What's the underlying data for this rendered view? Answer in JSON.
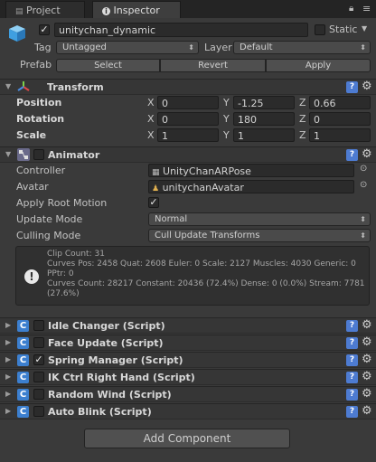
{
  "tabs": [
    {
      "label": "Project",
      "active": false
    },
    {
      "label": "Inspector",
      "active": true
    }
  ],
  "object": {
    "name": "unitychan_dynamic",
    "active": true,
    "static_label": "Static",
    "tag_label": "Tag",
    "tag_value": "Untagged",
    "layer_label": "Layer",
    "layer_value": "Default",
    "prefab_label": "Prefab",
    "prefab_buttons": [
      "Select",
      "Revert",
      "Apply"
    ]
  },
  "transform": {
    "title": "Transform",
    "rows": [
      {
        "label": "Position",
        "x": "0",
        "y": "-1.25",
        "z": "0.66"
      },
      {
        "label": "Rotation",
        "x": "0",
        "y": "180",
        "z": "0"
      },
      {
        "label": "Scale",
        "x": "1",
        "y": "1",
        "z": "1"
      }
    ],
    "axis_labels": [
      "X",
      "Y",
      "Z"
    ]
  },
  "animator": {
    "title": "Animator",
    "enabled": false,
    "controller_label": "Controller",
    "controller_value": "UnityChanARPose",
    "avatar_label": "Avatar",
    "avatar_value": "unitychanAvatar",
    "apply_root_motion_label": "Apply Root Motion",
    "apply_root_motion": true,
    "update_mode_label": "Update Mode",
    "update_mode_value": "Normal",
    "culling_mode_label": "Culling Mode",
    "culling_mode_value": "Cull Update Transforms",
    "info": "Clip Count: 31\nCurves Pos: 2458 Quat: 2608 Euler: 0 Scale: 2127 Muscles: 4030 Generic: 0 PPtr: 0\nCurves Count: 28217 Constant: 20436 (72.4%) Dense: 0 (0.0%) Stream: 7781 (27.6%)"
  },
  "scripts": [
    {
      "title": "Idle Changer (Script)",
      "enabled": false
    },
    {
      "title": "Face Update (Script)",
      "enabled": false
    },
    {
      "title": "Spring Manager (Script)",
      "enabled": true
    },
    {
      "title": "IK Ctrl Right Hand (Script)",
      "enabled": false
    },
    {
      "title": "Random Wind (Script)",
      "enabled": false
    },
    {
      "title": "Auto Blink (Script)",
      "enabled": false
    }
  ],
  "add_component_label": "Add Component",
  "icons": {
    "tab_lock": "lock-icon",
    "tab_menu": "menu-icon",
    "gameobject": "cube-icon",
    "help": "help-icon",
    "gear": "gear-icon",
    "script": "csharp-script-icon"
  },
  "colors": {
    "background": "#3a3a3a",
    "header": "#363636",
    "field": "#2b2b2b",
    "accent": "#4d7bd1"
  }
}
